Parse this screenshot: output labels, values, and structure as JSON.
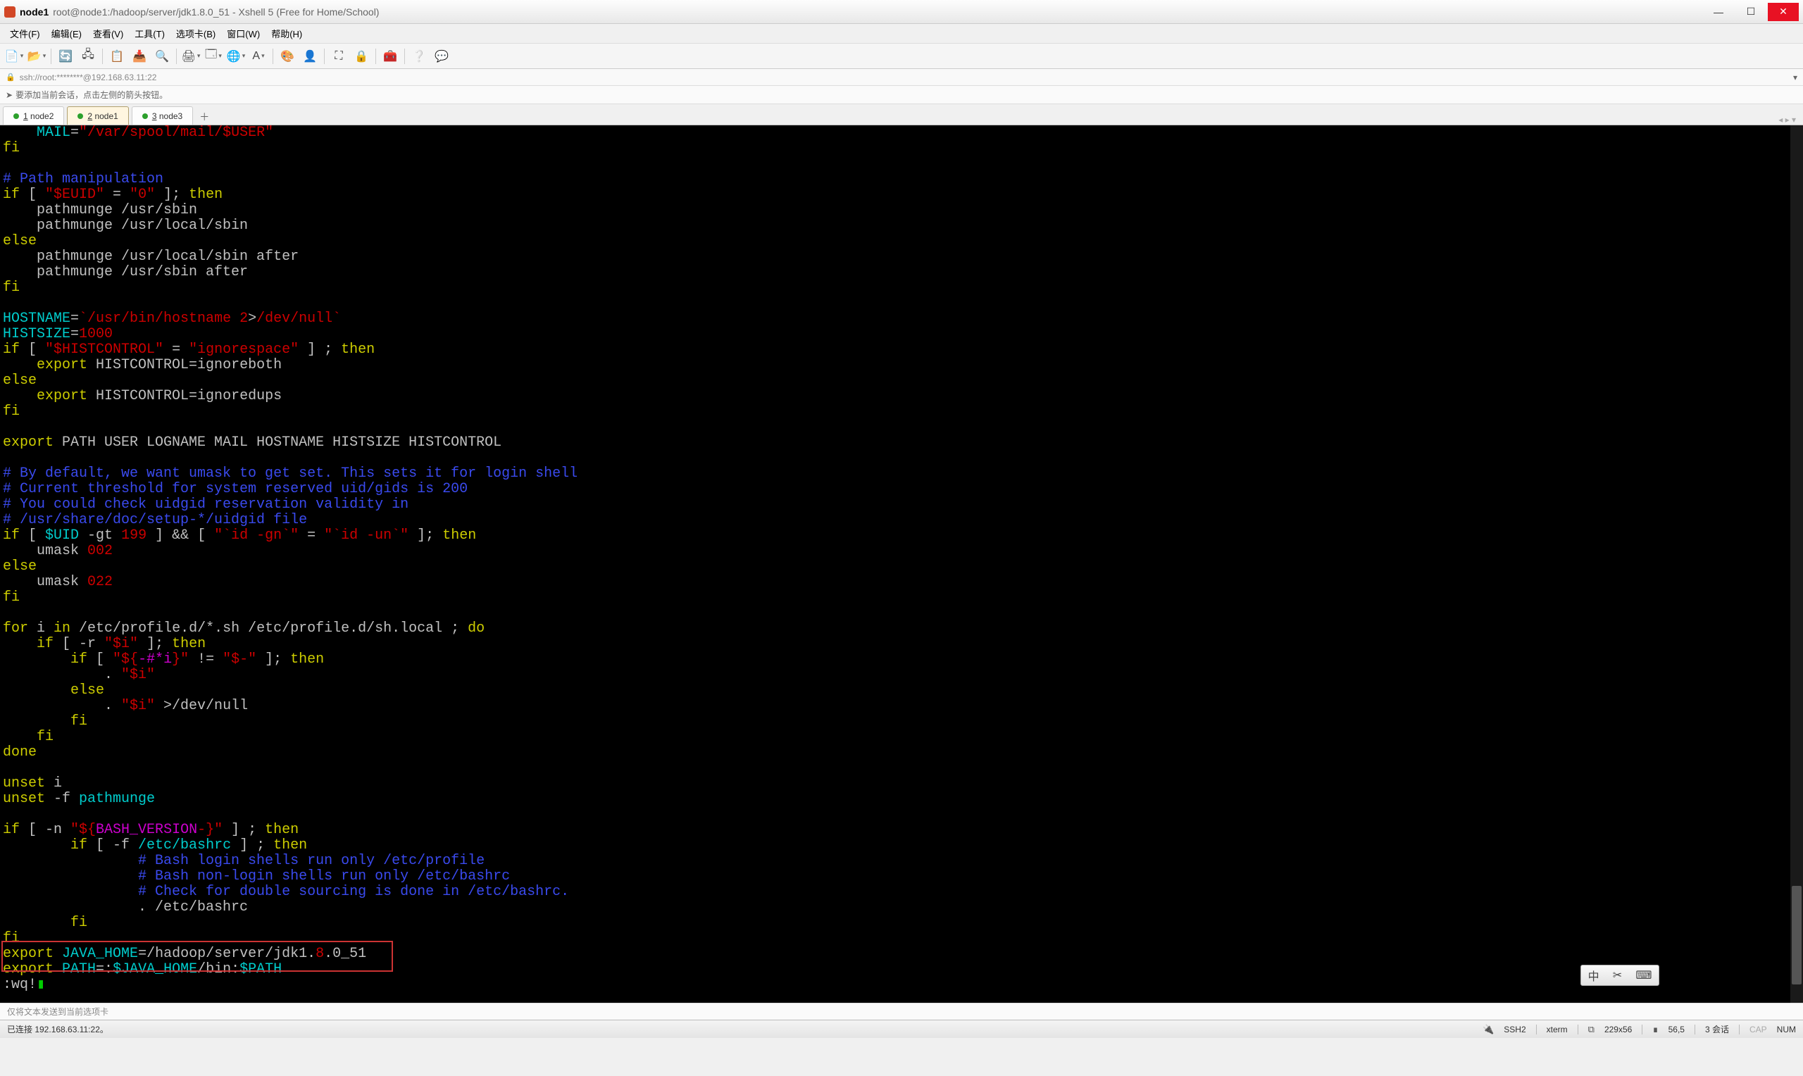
{
  "titlebar": {
    "title": "node1",
    "subtitle": "root@node1:/hadoop/server/jdk1.8.0_51 - Xshell 5 (Free for Home/School)"
  },
  "menus": {
    "file": "文件(F)",
    "edit": "编辑(E)",
    "view": "查看(V)",
    "tools": "工具(T)",
    "tabs": "选项卡(B)",
    "window": "窗口(W)",
    "help": "帮助(H)"
  },
  "address": {
    "text": "ssh://root:********@192.168.63.11:22"
  },
  "helper": {
    "text": "要添加当前会话，点击左侧的箭头按钮。"
  },
  "tabs": {
    "items": [
      {
        "label": "node2",
        "key": "1",
        "active": false
      },
      {
        "label": "node1",
        "key": "2",
        "active": true
      },
      {
        "label": "node3",
        "key": "3",
        "active": false
      }
    ]
  },
  "ime": {
    "a": "中",
    "b": "✂",
    "c": "⌨"
  },
  "bottomHint": "仅将文本发送到当前选项卡",
  "status": {
    "left": "已连接 192.168.63.11:22。",
    "ssh": "SSH2",
    "term": "xterm",
    "size": "229x56",
    "cursor": "56,5",
    "sessions": "3 会话",
    "cap": "CAP",
    "num": "NUM"
  },
  "terminal": {
    "lines": [
      [
        [
          "    ",
          "w"
        ],
        [
          "MAIL",
          "c"
        ],
        [
          "=",
          "w"
        ],
        [
          "\"/var/spool/mail/$USER\"",
          "r"
        ]
      ],
      [
        [
          "fi",
          "y"
        ]
      ],
      [
        [
          "",
          ""
        ]
      ],
      [
        [
          "# Path manipulation",
          "b"
        ]
      ],
      [
        [
          "if",
          "y"
        ],
        [
          " [ ",
          "w"
        ],
        [
          "\"$EUID\"",
          "r"
        ],
        [
          " = ",
          "w"
        ],
        [
          "\"0\"",
          "r"
        ],
        [
          " ]; ",
          "w"
        ],
        [
          "then",
          "y"
        ]
      ],
      [
        [
          "    pathmunge /usr/sbin",
          "w"
        ]
      ],
      [
        [
          "    pathmunge /usr/local/sbin",
          "w"
        ]
      ],
      [
        [
          "else",
          "y"
        ]
      ],
      [
        [
          "    pathmunge /usr/local/sbin after",
          "w"
        ]
      ],
      [
        [
          "    pathmunge /usr/sbin after",
          "w"
        ]
      ],
      [
        [
          "fi",
          "y"
        ]
      ],
      [
        [
          "",
          ""
        ]
      ],
      [
        [
          "HOSTNAME",
          "c"
        ],
        [
          "=",
          "w"
        ],
        [
          "`/usr/bin/hostname 2",
          "r"
        ],
        [
          ">",
          "w"
        ],
        [
          "/dev/null`",
          "r"
        ]
      ],
      [
        [
          "HISTSIZE",
          "c"
        ],
        [
          "=",
          "w"
        ],
        [
          "1000",
          "r"
        ]
      ],
      [
        [
          "if",
          "y"
        ],
        [
          " [ ",
          "w"
        ],
        [
          "\"$HISTCONTROL\"",
          "r"
        ],
        [
          " = ",
          "w"
        ],
        [
          "\"ignorespace\"",
          "r"
        ],
        [
          " ] ; ",
          "w"
        ],
        [
          "then",
          "y"
        ]
      ],
      [
        [
          "    ",
          "w"
        ],
        [
          "export",
          "y"
        ],
        [
          " HISTCONTROL=ignoreboth",
          "w"
        ]
      ],
      [
        [
          "else",
          "y"
        ]
      ],
      [
        [
          "    ",
          "w"
        ],
        [
          "export",
          "y"
        ],
        [
          " HISTCONTROL=ignoredups",
          "w"
        ]
      ],
      [
        [
          "fi",
          "y"
        ]
      ],
      [
        [
          "",
          ""
        ]
      ],
      [
        [
          "export",
          "y"
        ],
        [
          " PATH USER LOGNAME MAIL HOSTNAME HISTSIZE HISTCONTROL",
          "w"
        ]
      ],
      [
        [
          "",
          ""
        ]
      ],
      [
        [
          "# By default, we want umask to get set. This sets it for login shell",
          "b"
        ]
      ],
      [
        [
          "# Current threshold for system reserved uid/gids is 200",
          "b"
        ]
      ],
      [
        [
          "# You could check uidgid reservation validity in",
          "b"
        ]
      ],
      [
        [
          "# /usr/share/doc/setup-*/uidgid file",
          "b"
        ]
      ],
      [
        [
          "if",
          "y"
        ],
        [
          " [ ",
          "w"
        ],
        [
          "$UID",
          "c"
        ],
        [
          " -gt ",
          "w"
        ],
        [
          "199",
          "r"
        ],
        [
          " ] && [ ",
          "w"
        ],
        [
          "\"`id -gn`\"",
          "r"
        ],
        [
          " = ",
          "w"
        ],
        [
          "\"`id -un`\"",
          "r"
        ],
        [
          " ]; ",
          "w"
        ],
        [
          "then",
          "y"
        ]
      ],
      [
        [
          "    umask ",
          "w"
        ],
        [
          "002",
          "r"
        ]
      ],
      [
        [
          "else",
          "y"
        ]
      ],
      [
        [
          "    umask ",
          "w"
        ],
        [
          "022",
          "r"
        ]
      ],
      [
        [
          "fi",
          "y"
        ]
      ],
      [
        [
          "",
          ""
        ]
      ],
      [
        [
          "for",
          "y"
        ],
        [
          " i ",
          "w"
        ],
        [
          "in",
          "y"
        ],
        [
          " /etc/profile.d/*.sh /etc/profile.d/sh.local ; ",
          "w"
        ],
        [
          "do",
          "y"
        ]
      ],
      [
        [
          "    ",
          "w"
        ],
        [
          "if",
          "y"
        ],
        [
          " [ -r ",
          "w"
        ],
        [
          "\"$i\"",
          "r"
        ],
        [
          " ]; ",
          "w"
        ],
        [
          "then",
          "y"
        ]
      ],
      [
        [
          "        ",
          "w"
        ],
        [
          "if",
          "y"
        ],
        [
          " [ ",
          "w"
        ],
        [
          "\"${",
          "r"
        ],
        [
          "-#*i",
          "m"
        ],
        [
          "}\"",
          "r"
        ],
        [
          " != ",
          "w"
        ],
        [
          "\"$-\"",
          "r"
        ],
        [
          " ]; ",
          "w"
        ],
        [
          "then",
          "y"
        ]
      ],
      [
        [
          "            . ",
          "w"
        ],
        [
          "\"$i\"",
          "r"
        ]
      ],
      [
        [
          "        ",
          "w"
        ],
        [
          "else",
          "y"
        ]
      ],
      [
        [
          "            . ",
          "w"
        ],
        [
          "\"$i\"",
          "r"
        ],
        [
          " >/dev/null",
          "w"
        ]
      ],
      [
        [
          "        ",
          "w"
        ],
        [
          "fi",
          "y"
        ]
      ],
      [
        [
          "    ",
          "w"
        ],
        [
          "fi",
          "y"
        ]
      ],
      [
        [
          "done",
          "y"
        ]
      ],
      [
        [
          "",
          ""
        ]
      ],
      [
        [
          "unset",
          "y"
        ],
        [
          " i",
          "w"
        ]
      ],
      [
        [
          "unset",
          "y"
        ],
        [
          " -f ",
          "w"
        ],
        [
          "pathmunge",
          "c"
        ]
      ],
      [
        [
          "",
          ""
        ]
      ],
      [
        [
          "if",
          "y"
        ],
        [
          " [ -n ",
          "w"
        ],
        [
          "\"${",
          "r"
        ],
        [
          "BASH_VERSION",
          "m"
        ],
        [
          "-}\"",
          "r"
        ],
        [
          " ] ; ",
          "w"
        ],
        [
          "then",
          "y"
        ]
      ],
      [
        [
          "        ",
          "w"
        ],
        [
          "if",
          "y"
        ],
        [
          " [ -f ",
          "w"
        ],
        [
          "/etc/bashrc",
          "c"
        ],
        [
          " ] ; ",
          "w"
        ],
        [
          "then",
          "y"
        ]
      ],
      [
        [
          "                ",
          "w"
        ],
        [
          "# Bash login shells run only /etc/profile",
          "b"
        ]
      ],
      [
        [
          "                ",
          "w"
        ],
        [
          "# Bash non-login shells run only /etc/bashrc",
          "b"
        ]
      ],
      [
        [
          "                ",
          "w"
        ],
        [
          "# Check for double sourcing is done in /etc/bashrc.",
          "b"
        ]
      ],
      [
        [
          "                . /etc/bashrc",
          "w"
        ]
      ],
      [
        [
          "        ",
          "w"
        ],
        [
          "fi",
          "y"
        ]
      ],
      [
        [
          "fi",
          "y"
        ]
      ],
      [
        [
          "export",
          "y"
        ],
        [
          " ",
          "w"
        ],
        [
          "JAVA_HOME",
          "c"
        ],
        [
          "=/hadoop/server/jdk1.",
          "w"
        ],
        [
          "8",
          "r"
        ],
        [
          ".0_51",
          "w"
        ]
      ],
      [
        [
          "export",
          "y"
        ],
        [
          " ",
          "w"
        ],
        [
          "PATH",
          "c"
        ],
        [
          "=:",
          "w"
        ],
        [
          "$JAVA_HOME",
          "c"
        ],
        [
          "/bin:",
          "w"
        ],
        [
          "$PATH",
          "c"
        ]
      ],
      [
        [
          ":wq!",
          "w"
        ],
        [
          "▮",
          "g"
        ]
      ]
    ]
  }
}
